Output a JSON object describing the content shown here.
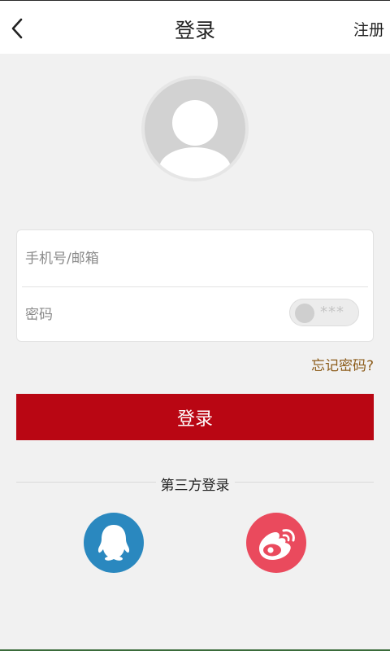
{
  "header": {
    "title": "登录",
    "register_label": "注册",
    "back_icon": "chevron-left-icon"
  },
  "avatar": {
    "icon": "user-placeholder-icon"
  },
  "form": {
    "account_placeholder": "手机号/邮箱",
    "password_placeholder": "密码",
    "password_toggle_mask": "***"
  },
  "forgot_password_label": "忘记密码?",
  "login_button_label": "登录",
  "third_party": {
    "title": "第三方登录",
    "providers": [
      {
        "name": "qq-login-button",
        "icon": "qq-icon",
        "color": "#2a88bf"
      },
      {
        "name": "weibo-login-button",
        "icon": "weibo-icon",
        "color": "#ea4a5d"
      }
    ]
  },
  "colors": {
    "accent": "#b90613",
    "forgot_link": "#8b5a17",
    "background": "#f1f1f1"
  }
}
